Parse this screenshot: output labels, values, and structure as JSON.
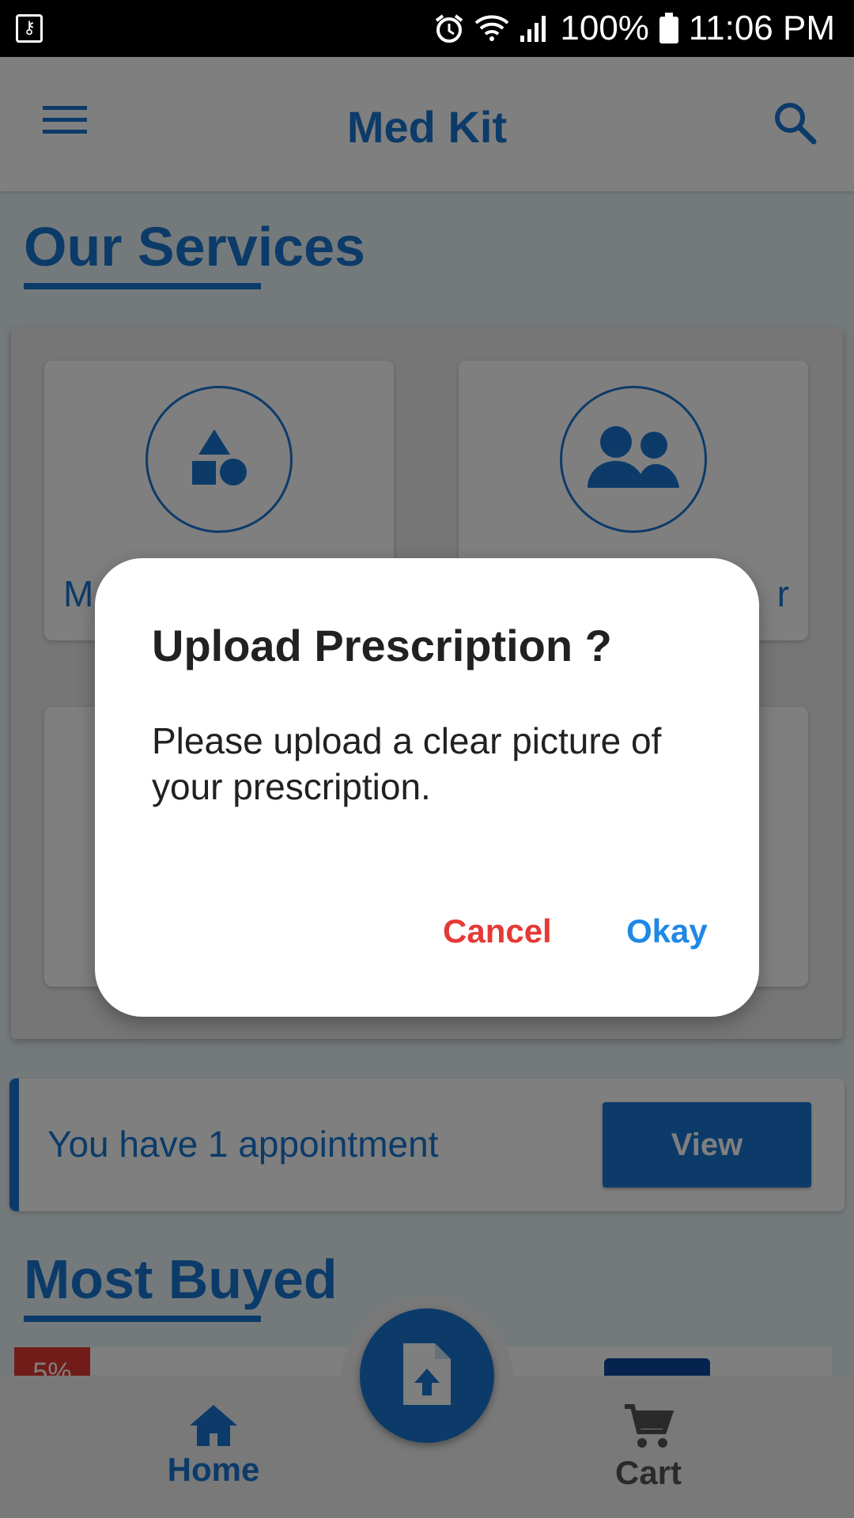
{
  "status_bar": {
    "battery_percent": "100%",
    "time": "11:06 PM"
  },
  "app_bar": {
    "title": "Med Kit"
  },
  "services": {
    "title": "Our Services",
    "cards": [
      {
        "label": "M"
      },
      {
        "label": "r"
      }
    ]
  },
  "appointment": {
    "text": "You have 1 appointment",
    "button_label": "View"
  },
  "most_buyed": {
    "title": "Most Buyed",
    "discount_badge": "5%"
  },
  "bottom_nav": {
    "home_label": "Home",
    "cart_label": "Cart"
  },
  "dialog": {
    "title": "Upload Prescription ?",
    "message": "Please upload a clear picture of your prescription.",
    "cancel_label": "Cancel",
    "okay_label": "Okay"
  },
  "colors": {
    "primary": "#1976d2",
    "cancel": "#e53935",
    "okay": "#1e88e5",
    "scrim": "rgba(0,0,0,0.5)"
  },
  "icons": [
    "key-icon",
    "alarm-icon",
    "wifi-icon",
    "signal-icon",
    "battery-icon",
    "menu-icon",
    "search-icon",
    "shapes-icon",
    "people-icon",
    "upload-file-icon",
    "home-icon",
    "cart-icon"
  ]
}
